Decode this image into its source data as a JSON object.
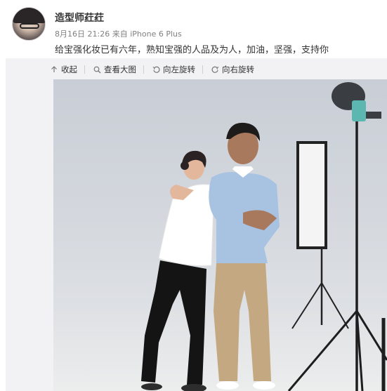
{
  "post": {
    "username": "造型师荭荭",
    "date": "8月16日 21:26",
    "source_prefix": "来自",
    "source": "iPhone 6 Plus",
    "text": "给宝强化妆已有六年，熟知宝强的人品及为人，加油，坚强，支持你"
  },
  "toolbar": {
    "collapse": "收起",
    "view_large": "查看大图",
    "rotate_left": "向左旋转",
    "rotate_right": "向右旋转"
  },
  "colors": {
    "link": "#333333",
    "muted": "#808080",
    "backdrop": "#d3d7dd"
  }
}
